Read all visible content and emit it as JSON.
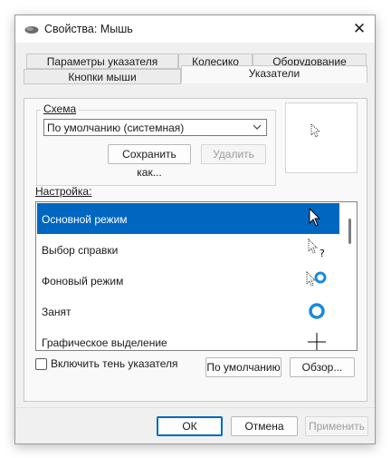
{
  "window": {
    "title": "Свойства: Мышь",
    "icon": "mouse-icon",
    "close_glyph": "✕"
  },
  "tabs": {
    "row_top": [
      {
        "label": "Параметры указателя"
      },
      {
        "label": "Колесико"
      },
      {
        "label": "Оборудование"
      }
    ],
    "row_bottom": [
      {
        "label": "Кнопки мыши"
      },
      {
        "label": "Указатели",
        "active": true
      }
    ]
  },
  "scheme": {
    "legend": "Схема",
    "selected": "По умолчанию (системная)",
    "save_label": "Сохранить как...",
    "delete_label": "Удалить"
  },
  "customize": {
    "label": "Настройка:",
    "items": [
      {
        "label": "Основной режим",
        "icon": "arrow-cursor-icon",
        "selected": true
      },
      {
        "label": "Выбор справки",
        "icon": "help-cursor-icon"
      },
      {
        "label": "Фоновый режим",
        "icon": "working-in-background-cursor-icon"
      },
      {
        "label": "Занят",
        "icon": "busy-cursor-icon"
      },
      {
        "label": "Графическое выделение",
        "icon": "crosshair-cursor-icon"
      }
    ]
  },
  "shadow_checkbox": {
    "label": "Включить тень указателя",
    "checked": false
  },
  "buttons": {
    "default_label": "По умолчанию",
    "browse_label": "Обзор...",
    "ok_label": "ОК",
    "cancel_label": "Отмена",
    "apply_label": "Применить"
  },
  "colors": {
    "accent": "#0067c0",
    "busy_ring": "#1a8ae0"
  }
}
